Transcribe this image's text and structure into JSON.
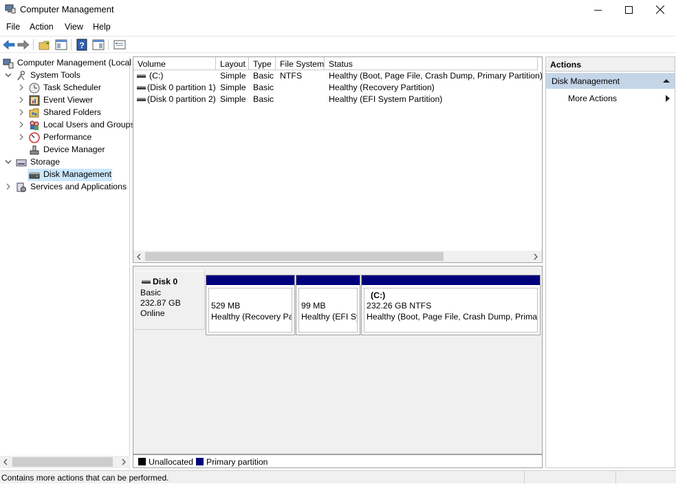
{
  "window": {
    "title": "Computer Management"
  },
  "menu": [
    "File",
    "Action",
    "View",
    "Help"
  ],
  "tree": {
    "root": "Computer Management (Local",
    "system_tools": "System Tools",
    "task_scheduler": "Task Scheduler",
    "event_viewer": "Event Viewer",
    "shared_folders": "Shared Folders",
    "local_users": "Local Users and Groups",
    "performance": "Performance",
    "device_manager": "Device Manager",
    "storage": "Storage",
    "disk_management": "Disk Management",
    "services": "Services and Applications"
  },
  "volumes": {
    "columns": [
      "Volume",
      "Layout",
      "Type",
      "File System",
      "Status"
    ],
    "rows": [
      {
        "volume": "(C:)",
        "layout": "Simple",
        "type": "Basic",
        "fs": "NTFS",
        "status": "Healthy (Boot, Page File, Crash Dump, Primary Partition)"
      },
      {
        "volume": "(Disk 0 partition 1)",
        "layout": "Simple",
        "type": "Basic",
        "fs": "",
        "status": "Healthy (Recovery Partition)"
      },
      {
        "volume": "(Disk 0 partition 2)",
        "layout": "Simple",
        "type": "Basic",
        "fs": "",
        "status": "Healthy (EFI System Partition)"
      }
    ]
  },
  "disk": {
    "name": "Disk 0",
    "type": "Basic",
    "size": "232.87 GB",
    "state": "Online",
    "partitions": [
      {
        "label": "",
        "size": "529 MB",
        "status": "Healthy (Recovery Par"
      },
      {
        "label": "",
        "size": "99 MB",
        "status": "Healthy (EFI Sys"
      },
      {
        "label": "(C:)",
        "size": "232.26 GB NTFS",
        "status": "Healthy (Boot, Page File, Crash Dump, Primary"
      }
    ]
  },
  "legend": {
    "unallocated": "Unallocated",
    "primary": "Primary partition",
    "unallocated_color": "#000000",
    "primary_color": "#00007d"
  },
  "actions": {
    "header": "Actions",
    "section": "Disk Management",
    "more": "More Actions"
  },
  "status_text": "Contains more actions that can be performed."
}
